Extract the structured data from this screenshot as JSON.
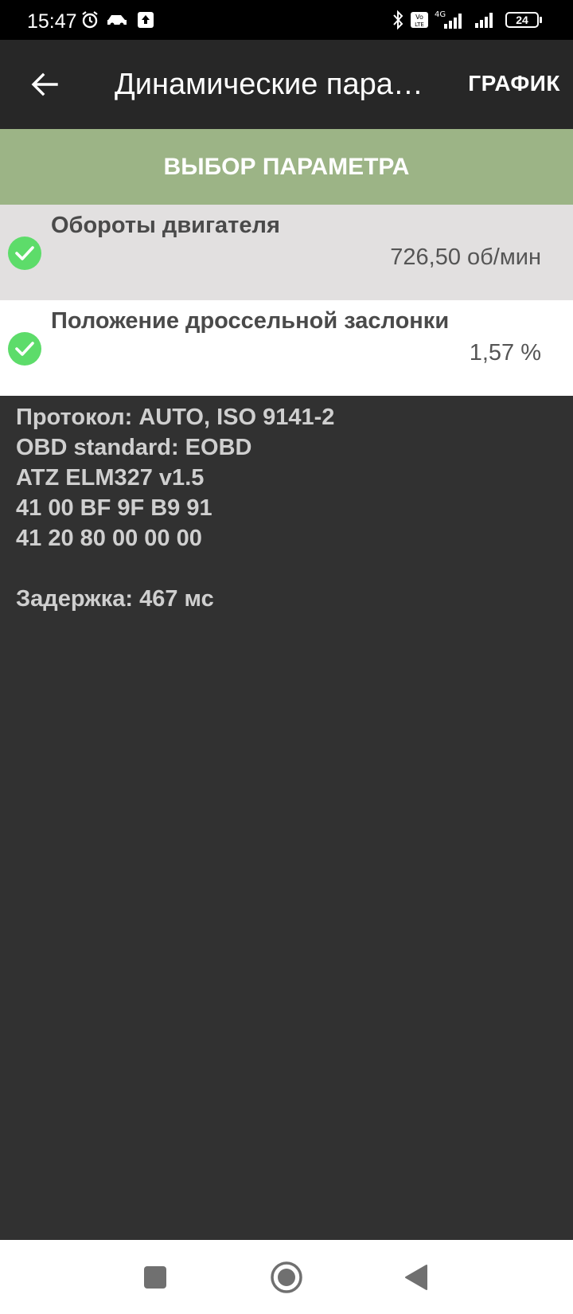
{
  "status_bar": {
    "time": "15:47",
    "battery": "24",
    "network": "4G",
    "icons": [
      "alarm-icon",
      "car-icon",
      "upload-icon",
      "bluetooth-icon",
      "volte-icon",
      "signal-icon",
      "battery-icon"
    ]
  },
  "app_bar": {
    "title": "Динамические пара…",
    "graph_label": "ГРАФИК"
  },
  "select_param_label": "ВЫБОР ПАРАМЕТРА",
  "parameters": [
    {
      "name": "Обороты двигателя",
      "value": "726,50 об/мин",
      "checked": true
    },
    {
      "name": "Положение дроссельной заслонки",
      "value": "1,57 %",
      "checked": true
    }
  ],
  "log": {
    "lines": [
      "Протокол: AUTO, ISO 9141-2",
      "OBD standard: EOBD",
      "ATZ ELM327 v1.5",
      "41 00 BF 9F B9 91",
      "41 20 80 00 00 00"
    ],
    "delay": "Задержка: 467 мс"
  },
  "colors": {
    "app_bar": "#272727",
    "accent_green": "#9cb486",
    "check_green": "#5ddc6a",
    "log_background": "#313131"
  }
}
